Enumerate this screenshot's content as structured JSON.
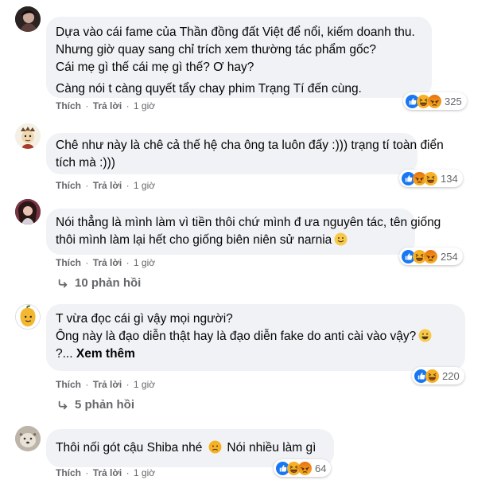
{
  "comments": [
    {
      "lines": [
        "Dựa vào cái fame của Thần đồng đất Việt để nổi, kiếm doanh thu.",
        "Nhưng giờ quay sang chỉ trích xem thường tác phẩm gốc?",
        "Cái mẹ gì thế cái mẹ gì thế? Ơ hay?",
        "Càng nói t càng quyết tẩy chay phim Trạng Tí đến cùng."
      ],
      "like": "Thích",
      "reply": "Trả lời",
      "time": "1 giờ",
      "reaction_count": "325"
    },
    {
      "lines": [
        "Chê như này là chê cả thế hệ cha ông ta luôn đấy :))) trạng tí toàn điển",
        "tích mà :)))"
      ],
      "like": "Thích",
      "reply": "Trả lời",
      "time": "1 giờ",
      "reaction_count": "134"
    },
    {
      "lines": [
        "Nói thẳng là mình làm vì tiền thôi chứ mình đ ưa nguyên tác, tên giống",
        "thôi mình làm lại hết cho giống biên niên sử narnia"
      ],
      "like": "Thích",
      "reply": "Trả lời",
      "time": "1 giờ",
      "reaction_count": "254",
      "replies": "10 phản hồi"
    },
    {
      "lines": [
        "T vừa đọc cái gì vậy mọi người?",
        "Ông này là đạo diễn thật hay là đạo diễn fake do anti cài vào vậy?",
        "?..."
      ],
      "see_more": "Xem thêm",
      "like": "Thích",
      "reply": "Trả lời",
      "time": "1 giờ",
      "reaction_count": "220",
      "replies": "5 phản hồi"
    },
    {
      "text_a": "Thôi nối gót cậu Shiba nhé",
      "text_b": "Nói nhiều làm gì",
      "like": "Thích",
      "reply": "Trả lời",
      "time": "1 giờ",
      "reaction_count": "64"
    }
  ],
  "colors": {
    "bubble": "#f0f2f5",
    "meta": "#65676b",
    "like": "#1877f2",
    "haha": "#f7b125",
    "angry": "#e9710f"
  },
  "icons": [
    "like-reaction-icon",
    "haha-reaction-icon",
    "angry-reaction-icon",
    "reply-arrow-icon",
    "smile-emoji",
    "sad-emoji"
  ]
}
